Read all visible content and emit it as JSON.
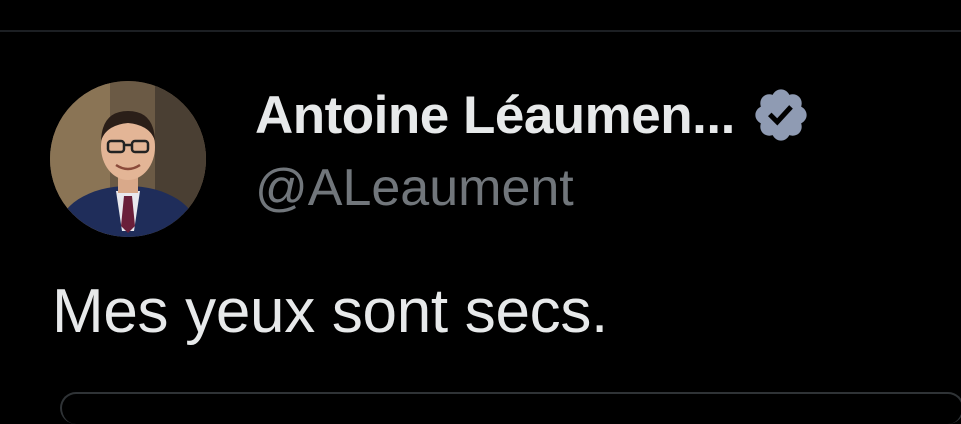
{
  "tweet": {
    "author": {
      "display_name": "Antoine Léaumen...",
      "handle": "@ALeaument",
      "verified": true,
      "verified_icon": "verified-badge-icon"
    },
    "text": "Mes yeux sont secs."
  },
  "colors": {
    "background": "#000000",
    "text_primary": "#e7e9ea",
    "text_secondary": "#71767b",
    "verified_badge": "#8f9bb3"
  }
}
